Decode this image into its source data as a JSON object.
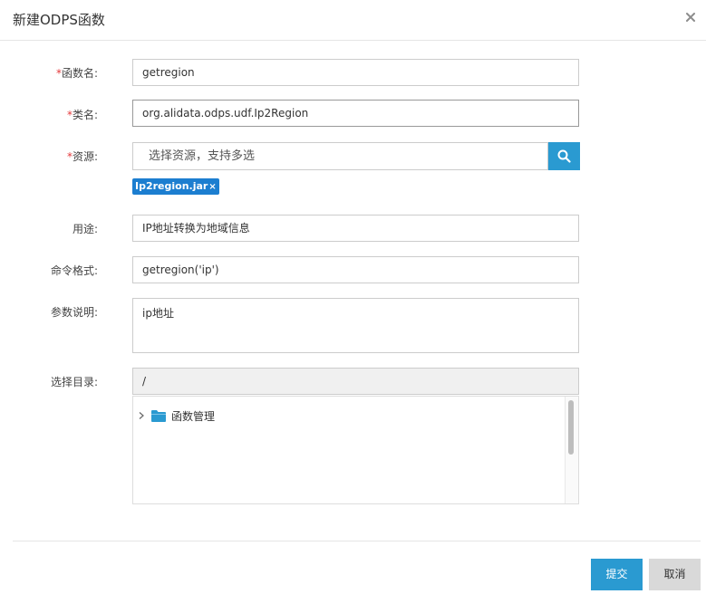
{
  "dialog": {
    "title": "新建ODPS函数",
    "close_glyph": "×"
  },
  "form": {
    "function_name": {
      "required_mark": "*",
      "label": "函数名:",
      "value": "getregion"
    },
    "class_name": {
      "required_mark": "*",
      "label": "类名:",
      "value": "org.alidata.odps.udf.Ip2Region"
    },
    "resource": {
      "required_mark": "*",
      "label": "资源:",
      "placeholder": "选择资源，支持多选",
      "search_icon": "search-icon",
      "selected_tag": "Ip2region.jar",
      "tag_close": "×"
    },
    "usage": {
      "label": "用途:",
      "value": "IP地址转换为地域信息"
    },
    "command_format": {
      "label": "命令格式:",
      "value": "getregion('ip')"
    },
    "param_desc": {
      "label": "参数说明:",
      "value": "ip地址"
    },
    "directory": {
      "label": "选择目录:",
      "value": "/",
      "tree": [
        {
          "label": "函数管理",
          "icon": "folder-icon",
          "expand_icon": "chevron-right-icon"
        }
      ]
    }
  },
  "footer": {
    "submit_label": "提交",
    "cancel_label": "取消"
  },
  "colors": {
    "primary": "#2a9ad1",
    "tag": "#1c7ed0",
    "required": "#e4393c",
    "cancel_bg": "#d9d9d9"
  }
}
